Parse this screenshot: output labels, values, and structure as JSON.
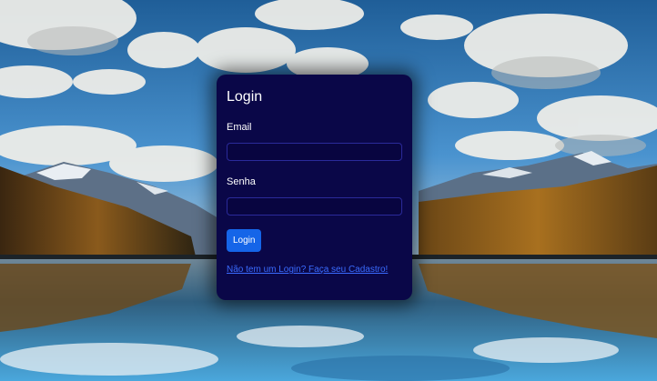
{
  "login_form": {
    "title": "Login",
    "email_label": "Email",
    "email_value": "",
    "password_label": "Senha",
    "password_value": "",
    "submit_label": "Login",
    "signup_link": "Não tem um Login? Faça seu Cadastro!"
  },
  "colors": {
    "card_background": "#0a0748",
    "button": "#1565e8",
    "link": "#3a6bff",
    "input_border": "#2a2a9a"
  },
  "background": {
    "icon": "mountain-lake-landscape"
  }
}
